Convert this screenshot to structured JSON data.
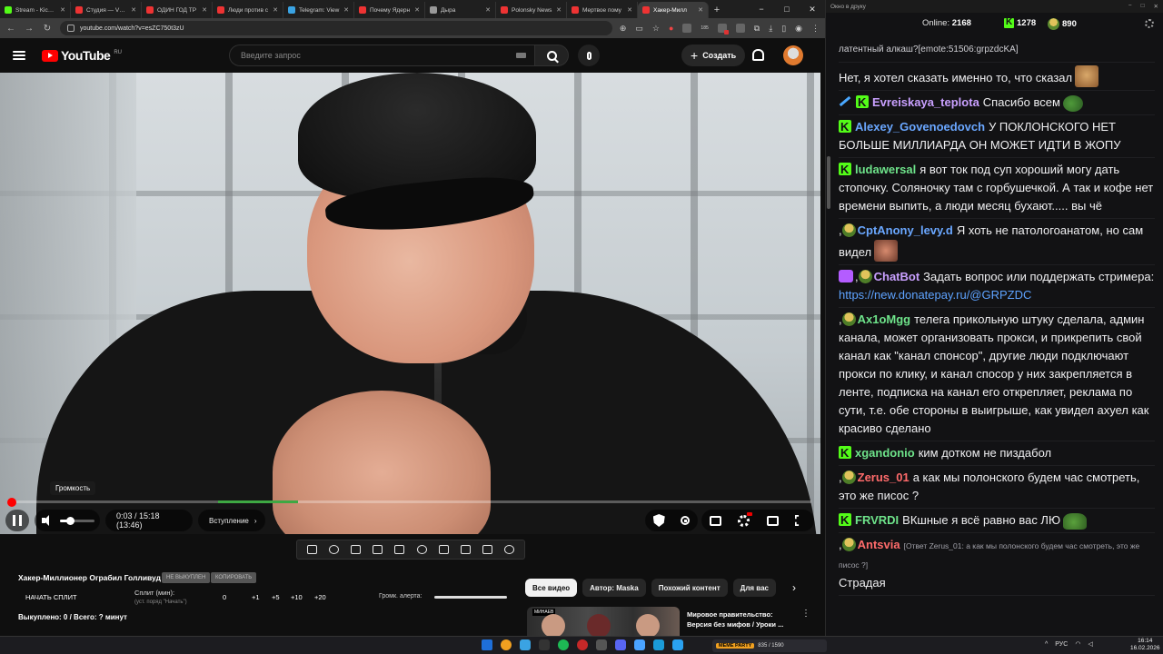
{
  "browser": {
    "tabs": [
      {
        "title": "Stream - Kick D",
        "color": "#53fc18",
        "active": false
      },
      {
        "title": "Студия — VK В",
        "color": "#e33",
        "active": false
      },
      {
        "title": "ОДИН ГОД ТР",
        "color": "#e33",
        "active": false
      },
      {
        "title": "Люди против с",
        "color": "#e33",
        "active": false
      },
      {
        "title": "Telegram: View",
        "color": "#3aa3e3",
        "active": false
      },
      {
        "title": "Почему Ядерн",
        "color": "#e33",
        "active": false
      },
      {
        "title": "Дыра",
        "color": "#999",
        "active": false
      },
      {
        "title": "Polonsky News",
        "color": "#e33",
        "active": false
      },
      {
        "title": "Мертвое пому",
        "color": "#e33",
        "active": false
      },
      {
        "title": "Хакер-Милл",
        "color": "#e33",
        "active": true
      }
    ],
    "new_tab": "+",
    "url": "youtube.com/watch?v=esZC750t3zU",
    "ext_badge": "185",
    "window_controls": [
      "−",
      "□",
      "✕"
    ]
  },
  "youtube": {
    "logo_text": "YouTube",
    "logo_region": "RU",
    "search_placeholder": "Введите запрос",
    "create_label": "Создать"
  },
  "player": {
    "tooltip": "Громкость",
    "time": "0:03 / 15:18 (13:46)",
    "chapter": "Вступление",
    "chapter_chevron": "›",
    "progress": 0.003,
    "sponsor_segment": [
      0.26,
      0.36
    ],
    "volume": 0.3
  },
  "below_video": {
    "title": "Хакер-Миллионер Ограбил Голливуд",
    "tag1": "НЕ ВЫКУПЛЕН",
    "tag2": "КОПИРОВАТЬ",
    "split_start": "НАЧАТЬ СПЛИТ",
    "split_label": "Сплит (мин):",
    "split_hint": "(уст. поряд \"Начать\")",
    "split_values": [
      "0",
      "+1",
      "+5",
      "+10",
      "+20"
    ],
    "alert_label": "Громк. алерта:",
    "watched": "Выкуплено: 0 / Всего: ? минут",
    "chips": [
      "Все видео",
      "Автор: Maska",
      "Похожий контент",
      "Для вас"
    ],
    "chip_next": "›",
    "rec_tag": "МИНАЕВ",
    "rec_title": "Мировое правительство: Версия без мифов / Уроки ...",
    "rec_more": "⋮"
  },
  "chat": {
    "window_title": "Окно в друку",
    "online_label": "Online:",
    "online_count": "2168",
    "kick_count": "1278",
    "other_count": "890",
    "messages": [
      {
        "user": "",
        "color": "#fff",
        "badges": [],
        "text": "латентный алкаш?[emote:51506:grpzdcKA]",
        "small": true
      },
      {
        "user": "",
        "color": "#fff",
        "badges": [],
        "text": "Нет, я хотел сказать именно то, что сказал",
        "emote": "cat"
      },
      {
        "user": "Evreiskaya_teplota",
        "color": "#c9a0ff",
        "badges": [
          "sword",
          "k"
        ],
        "text": "Спасибо всем",
        "emote": "pepe"
      },
      {
        "user": "Alexey_Govenoedovch",
        "color": "#6aa7ff",
        "badges": [
          "k"
        ],
        "text": "У ПОКЛОНСКОГО НЕТ БОЛЬШЕ МИЛЛИАРДА ОН МОЖЕТ ИДТИ В ЖОПУ"
      },
      {
        "user": "ludawersal",
        "color": "#6ee38a",
        "badges": [
          "k"
        ],
        "text": "я вот ток под суп хороший могу дать стопочку. Соляночку там с горбушечкой. А так и кофе нет времени выпить, а люди месяц бухают..... вы чё"
      },
      {
        "user": "CptAnony_levy.d",
        "color": "#6aa7ff",
        "badges": [
          "comma",
          "face"
        ],
        "text": "Я хоть не патологоанатом, но сам видел",
        "emote": "face"
      },
      {
        "user": "ChatBot",
        "color": "#c9a0ff",
        "badges": [
          "bot",
          "comma",
          "face"
        ],
        "text": "Задать вопрос или поддержать стримера: ",
        "link": "https://new.donatepay.ru/@GRPZDC"
      },
      {
        "user": "Ax1oMgg",
        "color": "#6ee38a",
        "badges": [
          "comma",
          "face"
        ],
        "text": "телега прикольную штуку сделала, админ канала, может организовать прокси, и прикрепить свой канал как \"канал спонсор\", другие люди подключают прокси по клику, и канал спосор у них закрепляется в ленте, подписка на канал его открепляет, реклама по сути, т.е. обе стороны в выигрыше, как увидел ахуел как красиво сделано"
      },
      {
        "user": "xgandonio",
        "color": "#6ee38a",
        "badges": [
          "k"
        ],
        "text": "ким дотком не пиздабол"
      },
      {
        "user": "Zerus_01",
        "color": "#ff6b6b",
        "badges": [
          "comma",
          "face"
        ],
        "text": "а как мы полонского будем час смотреть, это же писос ?"
      },
      {
        "user": "FRVRDI",
        "color": "#6ee38a",
        "badges": [
          "k"
        ],
        "text": "ВКшные я всё равно вас ЛЮ",
        "emote": "pepe2"
      },
      {
        "user": "Antsvia",
        "color": "#ff6b6b",
        "badges": [
          "comma",
          "face"
        ],
        "reply": "[Ответ Zerus_01: а как мы полонского будем час смотреть, это же писос ?]",
        "text": "Страдая"
      }
    ]
  },
  "taskbar": {
    "widget_logo": "MEME PARTY",
    "widget_text": "835 / 1590",
    "tray_lang": "РУС",
    "clock_time": "16:14",
    "clock_date": "16.02.2026",
    "icon_colors": [
      "#1e6fd9",
      "#f0a020",
      "#3aa3e3",
      "#333",
      "#1db954",
      "#c62828",
      "#555",
      "#5865f2",
      "#4aa3ff",
      "#1b9bd7",
      "#2aa1f0"
    ]
  }
}
